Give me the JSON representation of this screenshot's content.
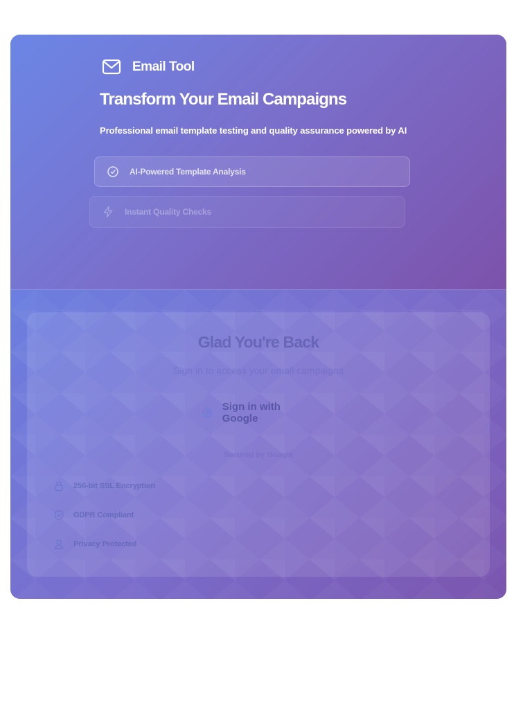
{
  "brand": {
    "name": "Email Tool",
    "icon": "envelope-icon"
  },
  "hero": {
    "headline": "Transform Your Email Campaigns",
    "subheadline": "Professional email template testing and quality assurance powered by AI",
    "features": [
      {
        "label": "AI-Powered Template Analysis",
        "icon": "check-circle-icon"
      },
      {
        "label": "Instant Quality Checks",
        "icon": "lightning-icon"
      }
    ]
  },
  "login": {
    "title": "Glad You're Back",
    "subtitle": "Sign in to access your email campaigns",
    "google_button": "Sign in with Google",
    "secured_note": "Secured by Google",
    "trust_items": [
      {
        "label": "256-bit SSL Encryption",
        "icon": "lock-icon"
      },
      {
        "label": "GDPR Compliant",
        "icon": "shield-check-icon"
      },
      {
        "label": "Privacy Protected",
        "icon": "user-shield-icon"
      }
    ]
  },
  "colors": {
    "gradient_start": "#6b86e6",
    "gradient_mid": "#7a70cc",
    "gradient_end": "#7c52ab",
    "text_light": "#ffffff"
  }
}
